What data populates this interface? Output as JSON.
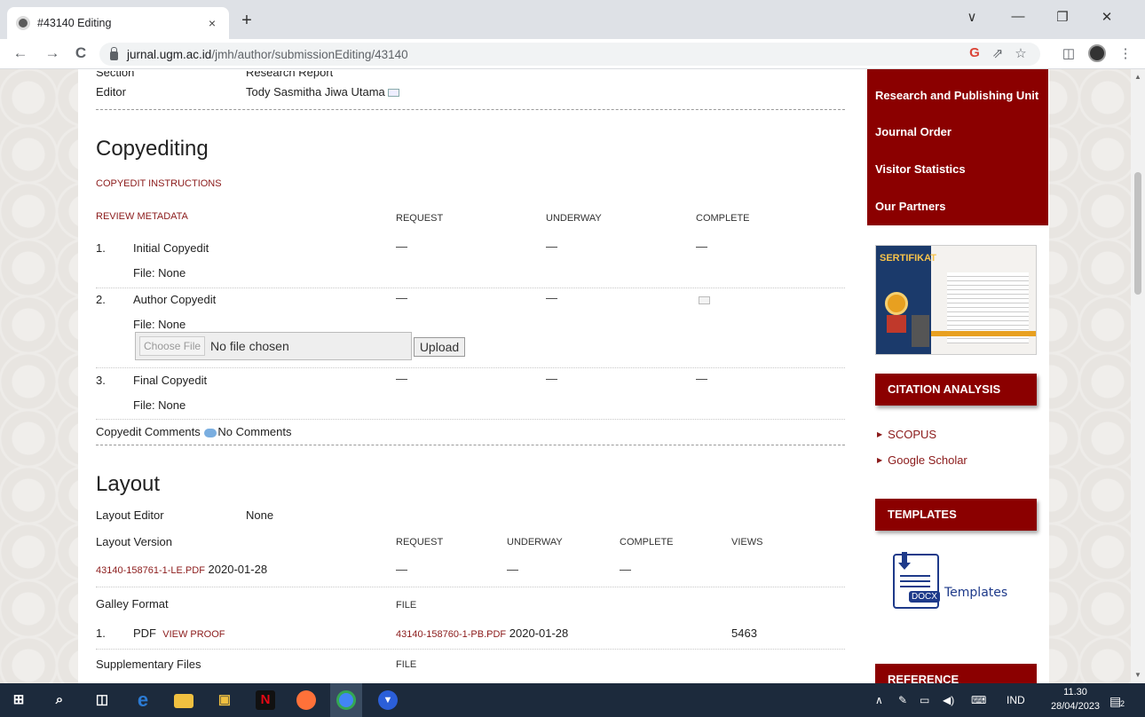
{
  "browser": {
    "tab_title": "#43140 Editing",
    "tab_close": "×",
    "new_tab": "+",
    "url_domain": "jurnal.ugm.ac.id",
    "url_path": "/jmh/author/submissionEditing/43140",
    "window_controls": [
      "∨",
      "—",
      "❐",
      "✕"
    ],
    "nav": {
      "back": "←",
      "forward": "→",
      "reload": "C"
    }
  },
  "submission": {
    "section_label": "Section",
    "section_value": "Research Report",
    "editor_label": "Editor",
    "editor_value": "Tody Sasmitha Jiwa Utama"
  },
  "copyediting": {
    "heading": "Copyediting",
    "instructions_link": "COPYEDIT INSTRUCTIONS",
    "review_metadata_link": "REVIEW METADATA",
    "col_request": "REQUEST",
    "col_underway": "UNDERWAY",
    "col_complete": "COMPLETE",
    "rows": [
      {
        "num": "1.",
        "title": "Initial Copyedit",
        "file": "File: None",
        "request": "—",
        "underway": "—",
        "complete": "—"
      },
      {
        "num": "2.",
        "title": "Author Copyedit",
        "file": "File: None",
        "request": "—",
        "underway": "—",
        "complete": ""
      },
      {
        "num": "3.",
        "title": "Final Copyedit",
        "file": "File: None",
        "request": "—",
        "underway": "—",
        "complete": "—"
      }
    ],
    "choose_file_label": "Choose File",
    "no_file_text": "No file chosen",
    "upload_label": "Upload",
    "comments_label": "Copyedit Comments",
    "comments_value": "No Comments"
  },
  "layout": {
    "heading": "Layout",
    "editor_label": "Layout Editor",
    "editor_value": "None",
    "version_label": "Layout Version",
    "col_request": "REQUEST",
    "col_underway": "UNDERWAY",
    "col_complete": "COMPLETE",
    "col_views": "VIEWS",
    "version_file": "43140-158761-1-LE.PDF",
    "version_date": "2020-01-28",
    "version_request": "—",
    "version_underway": "—",
    "version_complete": "—",
    "galley_label": "Galley Format",
    "galley_file_col": "FILE",
    "galley_num": "1.",
    "galley_format": "PDF",
    "galley_view_proof": "VIEW PROOF",
    "galley_file": "43140-158760-1-PB.PDF",
    "galley_date": "2020-01-28",
    "galley_views": "5463",
    "supp_label": "Supplementary Files",
    "supp_file_col": "FILE"
  },
  "sidebar": {
    "menu": [
      "Research and Publishing Unit",
      "Journal Order",
      "Visitor Statistics",
      "Our Partners"
    ],
    "cert_title": "SERTIFIKAT",
    "citation_heading": "CITATION ANALYSIS",
    "citation_links": [
      "SCOPUS",
      "Google Scholar"
    ],
    "templates_heading": "TEMPLATES",
    "templates_icon_label": "DOCX",
    "templates_text": "Templates",
    "reference_heading": "REFERENCE"
  },
  "taskbar": {
    "language": "IND",
    "time": "11.30",
    "date": "28/04/2023",
    "notifications": "2"
  },
  "colors": {
    "brand_red": "#8b0000",
    "link_red": "#8b1a1a",
    "taskbar": "#1c2a3c"
  }
}
